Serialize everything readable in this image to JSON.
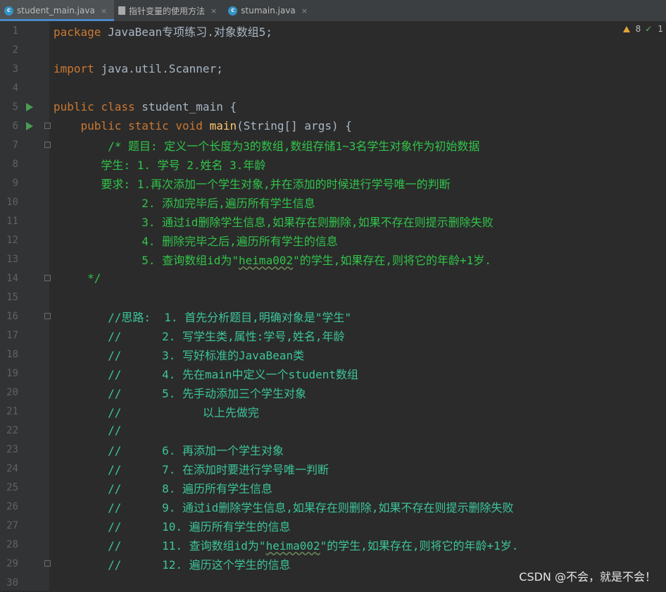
{
  "tabs": [
    {
      "label": "student_main.java",
      "icon": "java-class-icon",
      "active": true
    },
    {
      "label": "指针变量的使用方法",
      "icon": "document-icon",
      "active": false
    },
    {
      "label": "stumain.java",
      "icon": "java-class-icon",
      "active": false
    }
  ],
  "status": {
    "warnings": "8",
    "checks": "1"
  },
  "watermark": "CSDN @不会，就是不会！",
  "lines": [
    {
      "n": "1",
      "segs": [
        [
          "kw",
          "package "
        ],
        [
          "plain",
          "JavaBean专项练习.对象数组5;"
        ]
      ]
    },
    {
      "n": "2",
      "segs": []
    },
    {
      "n": "3",
      "segs": [
        [
          "kw",
          "import "
        ],
        [
          "plain",
          "java.util.Scanner;"
        ]
      ]
    },
    {
      "n": "4",
      "segs": []
    },
    {
      "n": "5",
      "run": true,
      "segs": [
        [
          "kw",
          "public class "
        ],
        [
          "plain",
          "student_main {"
        ]
      ]
    },
    {
      "n": "6",
      "run": true,
      "fold": true,
      "segs": [
        [
          "plain",
          "    "
        ],
        [
          "kw",
          "public static void "
        ],
        [
          "fn",
          "main"
        ],
        [
          "plain",
          "(String[] args) {"
        ]
      ]
    },
    {
      "n": "7",
      "fold": true,
      "segs": [
        [
          "cmt",
          "        /* 题目: 定义一个长度为3的数组,数组存储1~3名学生对象作为初始数据"
        ]
      ]
    },
    {
      "n": "8",
      "segs": [
        [
          "cmt",
          "       学生: 1. 学号 2.姓名 3.年龄"
        ]
      ]
    },
    {
      "n": "9",
      "segs": [
        [
          "cmt",
          "       要求: 1.再次添加一个学生对象,并在添加的时候进行学号唯一的判断"
        ]
      ]
    },
    {
      "n": "10",
      "segs": [
        [
          "cmt",
          "             2. 添加完毕后,遍历所有学生信息"
        ]
      ]
    },
    {
      "n": "11",
      "segs": [
        [
          "cmt",
          "             3. 通过id删除学生信息,如果存在则删除,如果不存在则提示删除失败"
        ]
      ]
    },
    {
      "n": "12",
      "segs": [
        [
          "cmt",
          "             4. 删除完毕之后,遍历所有学生的信息"
        ]
      ]
    },
    {
      "n": "13",
      "segs": [
        [
          "cmt",
          "             5. 查询数组id为\""
        ],
        [
          "cmtu",
          "heima002"
        ],
        [
          "cmt",
          "\"的学生,如果存在,则将它的年龄+1岁."
        ]
      ]
    },
    {
      "n": "14",
      "fold": true,
      "segs": [
        [
          "cmt",
          "     */"
        ]
      ]
    },
    {
      "n": "15",
      "segs": []
    },
    {
      "n": "16",
      "fold": true,
      "segs": [
        [
          "cmt2",
          "        //思路:  1. 首先分析题目,明确对象是\"学生\""
        ]
      ]
    },
    {
      "n": "17",
      "segs": [
        [
          "cmt2",
          "        //      2. 写学生类,属性:学号,姓名,年龄"
        ]
      ]
    },
    {
      "n": "18",
      "segs": [
        [
          "cmt2",
          "        //      3. 写好标准的JavaBean类"
        ]
      ]
    },
    {
      "n": "19",
      "segs": [
        [
          "cmt2",
          "        //      4. 先在main中定义一个student数组"
        ]
      ]
    },
    {
      "n": "20",
      "segs": [
        [
          "cmt2",
          "        //      5. 先手动添加三个学生对象"
        ]
      ]
    },
    {
      "n": "21",
      "segs": [
        [
          "cmt2",
          "        //            以上先做完"
        ]
      ]
    },
    {
      "n": "22",
      "segs": [
        [
          "cmt2",
          "        //"
        ]
      ]
    },
    {
      "n": "23",
      "segs": [
        [
          "cmt2",
          "        //      6. 再添加一个学生对象"
        ]
      ]
    },
    {
      "n": "24",
      "segs": [
        [
          "cmt2",
          "        //      7. 在添加时要进行学号唯一判断"
        ]
      ]
    },
    {
      "n": "25",
      "segs": [
        [
          "cmt2",
          "        //      8. 遍历所有学生信息"
        ]
      ]
    },
    {
      "n": "26",
      "segs": [
        [
          "cmt2",
          "        //      9. 通过id删除学生信息,如果存在则删除,如果不存在则提示删除失败"
        ]
      ]
    },
    {
      "n": "27",
      "segs": [
        [
          "cmt2",
          "        //      10. 遍历所有学生的信息"
        ]
      ]
    },
    {
      "n": "28",
      "segs": [
        [
          "cmt2",
          "        //      11. 查询数组id为\""
        ],
        [
          "cmt2u",
          "heima002"
        ],
        [
          "cmt2",
          "\"的学生,如果存在,则将它的年龄+1岁."
        ]
      ]
    },
    {
      "n": "29",
      "fold": true,
      "segs": [
        [
          "cmt2",
          "        //      12. 遍历这个学生的信息"
        ]
      ]
    },
    {
      "n": "30",
      "segs": []
    }
  ]
}
